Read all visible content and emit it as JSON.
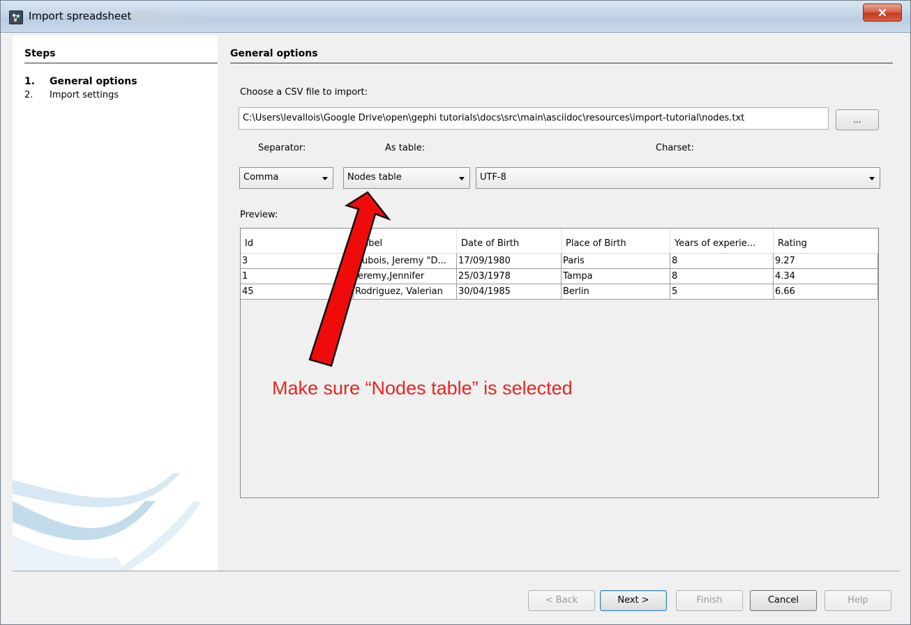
{
  "window": {
    "title": "Import spreadsheet"
  },
  "steps": {
    "heading": "Steps",
    "items": [
      {
        "num": "1.",
        "label": "General options"
      },
      {
        "num": "2.",
        "label": "Import settings"
      }
    ]
  },
  "general": {
    "heading": "General options",
    "csv_label": "Choose a CSV file to import:",
    "file_path": "C:\\Users\\levallois\\Google Drive\\open\\gephi tutorials\\docs\\src\\main\\asciidoc\\resources\\import-tutorial\\nodes.txt",
    "browse_label": "...",
    "separator_label": "Separator:",
    "separator_value": "Comma",
    "as_table_label": "As table:",
    "as_table_value": "Nodes table",
    "charset_label": "Charset:",
    "charset_value": "UTF-8",
    "preview_label": "Preview:"
  },
  "preview": {
    "columns": [
      "Id",
      "Label",
      "Date of Birth",
      "Place of Birth",
      "Years of experie...",
      "Rating"
    ],
    "rows": [
      [
        "3",
        "Dubois, Jeremy \"D...",
        "17/09/1980",
        "Paris",
        "8",
        "9.27"
      ],
      [
        "1",
        "Jeremy,Jennifer",
        "25/03/1978",
        "Tampa",
        "8",
        "4.34"
      ],
      [
        "45",
        "Rodriguez, Valerian",
        "30/04/1985",
        "Berlin",
        "5",
        "6.66"
      ]
    ]
  },
  "annotation": {
    "text": "Make sure “Nodes table” is selected",
    "color": "#e8251f"
  },
  "buttons": {
    "back": "< Back",
    "next": "Next >",
    "finish": "Finish",
    "cancel": "Cancel",
    "help": "Help"
  }
}
